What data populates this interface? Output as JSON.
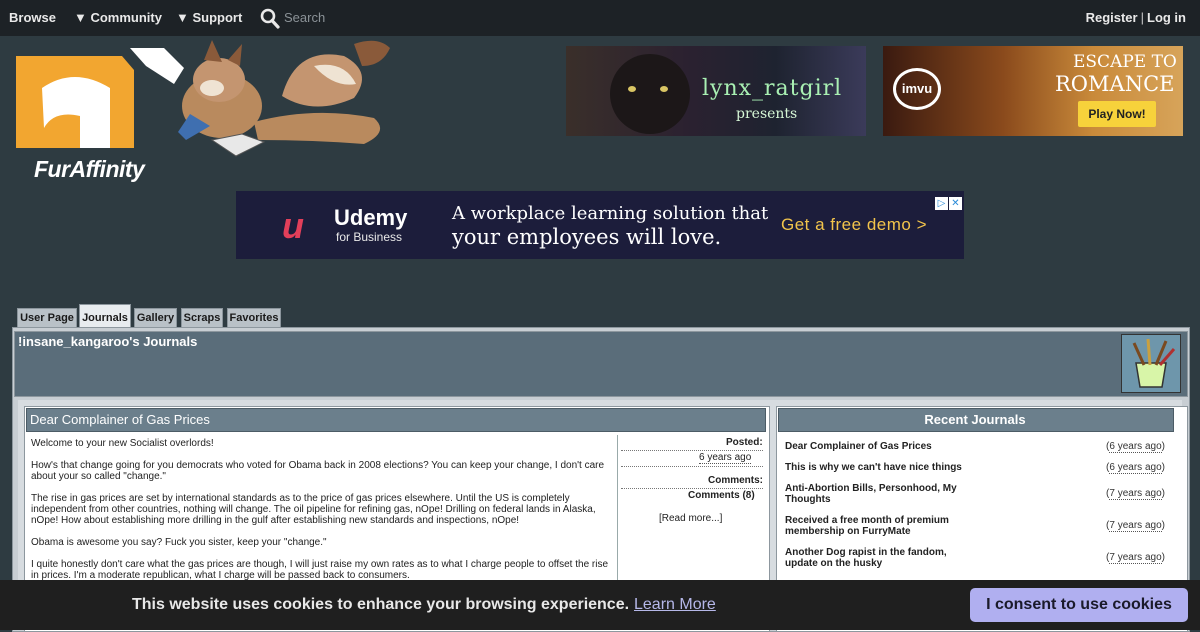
{
  "topnav": {
    "browse": "Browse",
    "community": "▼ Community",
    "support": "▼ Support",
    "search_placeholder": "Search",
    "register": "Register",
    "login": "Log in",
    "separator": "|"
  },
  "logo": {
    "text": "FurAffinity"
  },
  "ads": {
    "lynx": {
      "line1": "lynx_ratgirl",
      "line2": "presents"
    },
    "imvu": {
      "badge": "imvu",
      "line1": "ESCAPE TO",
      "line2": "ROMANCE",
      "button": "Play Now!"
    },
    "udemy": {
      "mark": "u",
      "brand": "Udemy",
      "sub": "for Business",
      "tagline1": "A workplace learning solution that",
      "tagline2": "your employees will love.",
      "cta": "Get a free demo >",
      "icons": [
        "▷",
        "✕"
      ]
    }
  },
  "tabs": [
    {
      "label": "User Page",
      "active": false
    },
    {
      "label": "Journals",
      "active": true
    },
    {
      "label": "Gallery",
      "active": false
    },
    {
      "label": "Scraps",
      "active": false
    },
    {
      "label": "Favorites",
      "active": false
    }
  ],
  "profile": {
    "title": "!insane_kangaroo's Journals"
  },
  "journal": {
    "title": "Dear Complainer of Gas Prices",
    "paragraphs": [
      "Welcome to your new Socialist overlords!",
      "How's that change going for you democrats who voted for Obama back in 2008 elections? You can keep your change, I don't care about your so called \"change.\"",
      "The rise in gas prices are set by international standards as to the price of gas prices elsewhere. Until the US is completely independent from other countries, nothing will change. The oil pipeline for refining gas, nOpe! Drilling on federal lands in Alaska, nOpe! How about establishing more drilling in the gulf after establishing new standards and inspections, nOpe!",
      "Obama is awesome you say? Fuck you sister, keep your \"change.\"",
      "I quite honestly don't care what the gas prices are though, I will just raise my own rates as to what I charge people to offset the rise in prices. I'm a moderate republican, what I charge will be passed back to consumers."
    ],
    "posted_label": "Posted:",
    "posted_value": "6 years ago",
    "comments_label": "Comments:",
    "comments_value": "Comments (8)",
    "read_more": "[Read more...]"
  },
  "recent": {
    "title": "Recent Journals",
    "items": [
      {
        "title": "Dear Complainer of Gas Prices",
        "date": "6 years ago"
      },
      {
        "title": "This is why we can't have nice things",
        "date": "6 years ago"
      },
      {
        "title": "Anti-Abortion Bills, Personhood, My Thoughts",
        "date": "7 years ago"
      },
      {
        "title": "Received a free month of premium membership on FurryMate",
        "date": "7 years ago"
      },
      {
        "title": "Another Dog rapist in the fandom, update on the husky",
        "date": "7 years ago"
      }
    ]
  },
  "cookie": {
    "text": "This website uses cookies to enhance your browsing experience.",
    "link": "Learn More",
    "button": "I consent to use cookies"
  },
  "colors": {
    "nav_bg": "#1d2226",
    "page_bg": "#2e3b41",
    "header_bar": "#6b7f8c",
    "cookie_button": "#b0aff0"
  }
}
